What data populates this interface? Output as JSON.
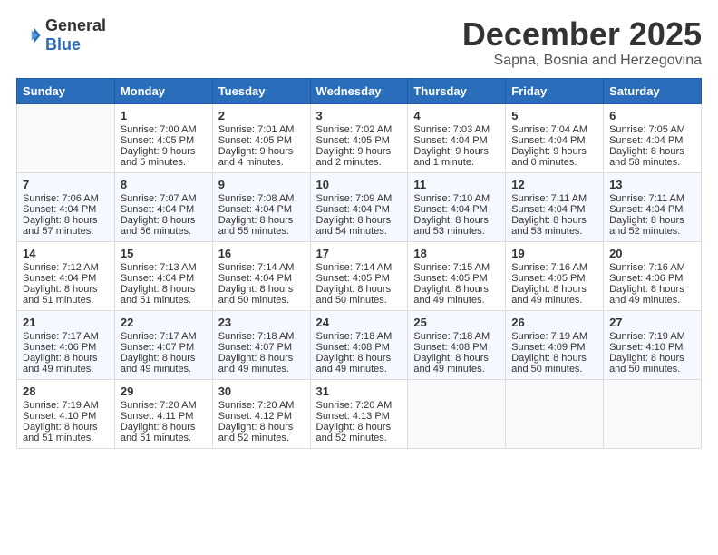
{
  "logo": {
    "general": "General",
    "blue": "Blue"
  },
  "title": "December 2025",
  "location": "Sapna, Bosnia and Herzegovina",
  "days_of_week": [
    "Sunday",
    "Monday",
    "Tuesday",
    "Wednesday",
    "Thursday",
    "Friday",
    "Saturday"
  ],
  "weeks": [
    [
      {
        "day": "",
        "info": ""
      },
      {
        "day": "1",
        "sunrise": "7:00 AM",
        "sunset": "4:05 PM",
        "daylight": "9 hours and 5 minutes."
      },
      {
        "day": "2",
        "sunrise": "7:01 AM",
        "sunset": "4:05 PM",
        "daylight": "9 hours and 4 minutes."
      },
      {
        "day": "3",
        "sunrise": "7:02 AM",
        "sunset": "4:05 PM",
        "daylight": "9 hours and 2 minutes."
      },
      {
        "day": "4",
        "sunrise": "7:03 AM",
        "sunset": "4:04 PM",
        "daylight": "9 hours and 1 minute."
      },
      {
        "day": "5",
        "sunrise": "7:04 AM",
        "sunset": "4:04 PM",
        "daylight": "9 hours and 0 minutes."
      },
      {
        "day": "6",
        "sunrise": "7:05 AM",
        "sunset": "4:04 PM",
        "daylight": "8 hours and 58 minutes."
      }
    ],
    [
      {
        "day": "7",
        "sunrise": "7:06 AM",
        "sunset": "4:04 PM",
        "daylight": "8 hours and 57 minutes."
      },
      {
        "day": "8",
        "sunrise": "7:07 AM",
        "sunset": "4:04 PM",
        "daylight": "8 hours and 56 minutes."
      },
      {
        "day": "9",
        "sunrise": "7:08 AM",
        "sunset": "4:04 PM",
        "daylight": "8 hours and 55 minutes."
      },
      {
        "day": "10",
        "sunrise": "7:09 AM",
        "sunset": "4:04 PM",
        "daylight": "8 hours and 54 minutes."
      },
      {
        "day": "11",
        "sunrise": "7:10 AM",
        "sunset": "4:04 PM",
        "daylight": "8 hours and 53 minutes."
      },
      {
        "day": "12",
        "sunrise": "7:11 AM",
        "sunset": "4:04 PM",
        "daylight": "8 hours and 53 minutes."
      },
      {
        "day": "13",
        "sunrise": "7:11 AM",
        "sunset": "4:04 PM",
        "daylight": "8 hours and 52 minutes."
      }
    ],
    [
      {
        "day": "14",
        "sunrise": "7:12 AM",
        "sunset": "4:04 PM",
        "daylight": "8 hours and 51 minutes."
      },
      {
        "day": "15",
        "sunrise": "7:13 AM",
        "sunset": "4:04 PM",
        "daylight": "8 hours and 51 minutes."
      },
      {
        "day": "16",
        "sunrise": "7:14 AM",
        "sunset": "4:04 PM",
        "daylight": "8 hours and 50 minutes."
      },
      {
        "day": "17",
        "sunrise": "7:14 AM",
        "sunset": "4:05 PM",
        "daylight": "8 hours and 50 minutes."
      },
      {
        "day": "18",
        "sunrise": "7:15 AM",
        "sunset": "4:05 PM",
        "daylight": "8 hours and 49 minutes."
      },
      {
        "day": "19",
        "sunrise": "7:16 AM",
        "sunset": "4:05 PM",
        "daylight": "8 hours and 49 minutes."
      },
      {
        "day": "20",
        "sunrise": "7:16 AM",
        "sunset": "4:06 PM",
        "daylight": "8 hours and 49 minutes."
      }
    ],
    [
      {
        "day": "21",
        "sunrise": "7:17 AM",
        "sunset": "4:06 PM",
        "daylight": "8 hours and 49 minutes."
      },
      {
        "day": "22",
        "sunrise": "7:17 AM",
        "sunset": "4:07 PM",
        "daylight": "8 hours and 49 minutes."
      },
      {
        "day": "23",
        "sunrise": "7:18 AM",
        "sunset": "4:07 PM",
        "daylight": "8 hours and 49 minutes."
      },
      {
        "day": "24",
        "sunrise": "7:18 AM",
        "sunset": "4:08 PM",
        "daylight": "8 hours and 49 minutes."
      },
      {
        "day": "25",
        "sunrise": "7:18 AM",
        "sunset": "4:08 PM",
        "daylight": "8 hours and 49 minutes."
      },
      {
        "day": "26",
        "sunrise": "7:19 AM",
        "sunset": "4:09 PM",
        "daylight": "8 hours and 50 minutes."
      },
      {
        "day": "27",
        "sunrise": "7:19 AM",
        "sunset": "4:10 PM",
        "daylight": "8 hours and 50 minutes."
      }
    ],
    [
      {
        "day": "28",
        "sunrise": "7:19 AM",
        "sunset": "4:10 PM",
        "daylight": "8 hours and 51 minutes."
      },
      {
        "day": "29",
        "sunrise": "7:20 AM",
        "sunset": "4:11 PM",
        "daylight": "8 hours and 51 minutes."
      },
      {
        "day": "30",
        "sunrise": "7:20 AM",
        "sunset": "4:12 PM",
        "daylight": "8 hours and 52 minutes."
      },
      {
        "day": "31",
        "sunrise": "7:20 AM",
        "sunset": "4:13 PM",
        "daylight": "8 hours and 52 minutes."
      },
      {
        "day": "",
        "info": ""
      },
      {
        "day": "",
        "info": ""
      },
      {
        "day": "",
        "info": ""
      }
    ]
  ],
  "labels": {
    "sunrise": "Sunrise: ",
    "sunset": "Sunset: ",
    "daylight": "Daylight: "
  }
}
